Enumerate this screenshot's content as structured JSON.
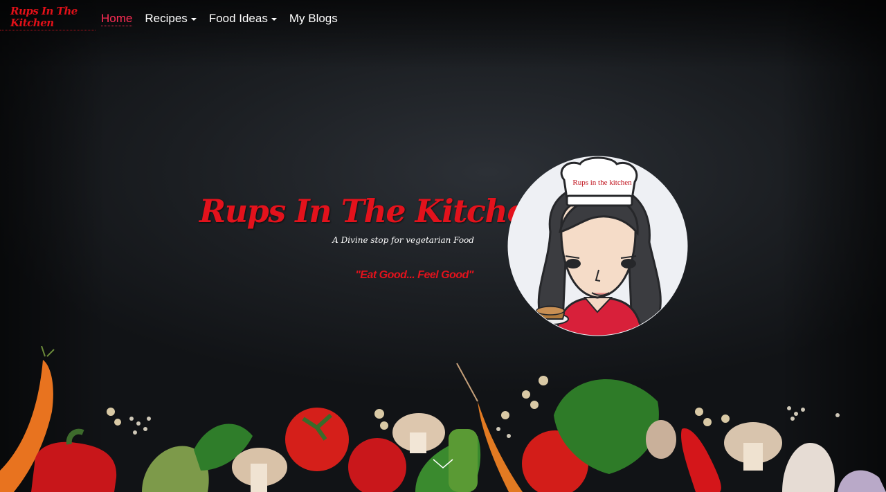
{
  "brand": {
    "line1": "Rups In The",
    "line2": "Kitchen"
  },
  "nav": {
    "items": [
      {
        "label": "Home",
        "active": true,
        "dropdown": false
      },
      {
        "label": "Recipes",
        "active": false,
        "dropdown": true
      },
      {
        "label": "Food Ideas",
        "active": false,
        "dropdown": true
      },
      {
        "label": "My Blogs",
        "active": false,
        "dropdown": false
      }
    ]
  },
  "hero": {
    "title": "Rups In The Kitchen",
    "subtitle": "A Divine stop for vegetarian Food",
    "tagline": "\"Eat Good... Feel Good\"",
    "logo_text": "Rups in the kitchen"
  },
  "colors": {
    "accent": "#e3121c",
    "nav_active": "#ff2d55",
    "background": "#1c1f23"
  },
  "icons": {
    "scroll": "chevron-down-icon"
  }
}
